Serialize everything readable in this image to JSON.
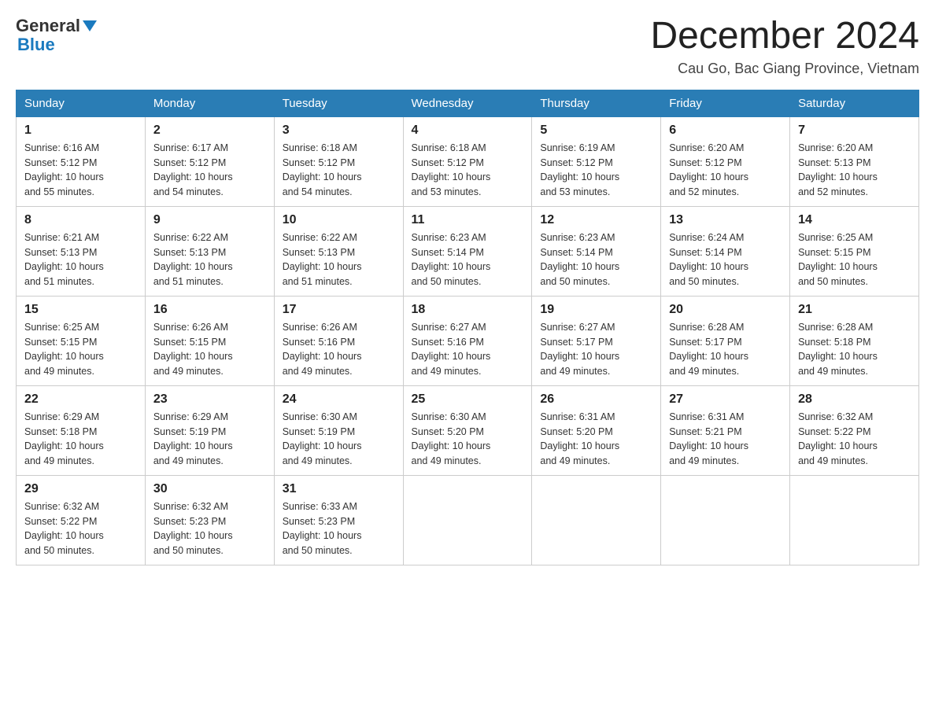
{
  "header": {
    "logo_general": "General",
    "logo_blue": "Blue",
    "month_title": "December 2024",
    "location": "Cau Go, Bac Giang Province, Vietnam"
  },
  "days_of_week": [
    "Sunday",
    "Monday",
    "Tuesday",
    "Wednesday",
    "Thursday",
    "Friday",
    "Saturday"
  ],
  "weeks": [
    [
      {
        "day": "1",
        "sunrise": "6:16 AM",
        "sunset": "5:12 PM",
        "daylight": "10 hours and 55 minutes."
      },
      {
        "day": "2",
        "sunrise": "6:17 AM",
        "sunset": "5:12 PM",
        "daylight": "10 hours and 54 minutes."
      },
      {
        "day": "3",
        "sunrise": "6:18 AM",
        "sunset": "5:12 PM",
        "daylight": "10 hours and 54 minutes."
      },
      {
        "day": "4",
        "sunrise": "6:18 AM",
        "sunset": "5:12 PM",
        "daylight": "10 hours and 53 minutes."
      },
      {
        "day": "5",
        "sunrise": "6:19 AM",
        "sunset": "5:12 PM",
        "daylight": "10 hours and 53 minutes."
      },
      {
        "day": "6",
        "sunrise": "6:20 AM",
        "sunset": "5:12 PM",
        "daylight": "10 hours and 52 minutes."
      },
      {
        "day": "7",
        "sunrise": "6:20 AM",
        "sunset": "5:13 PM",
        "daylight": "10 hours and 52 minutes."
      }
    ],
    [
      {
        "day": "8",
        "sunrise": "6:21 AM",
        "sunset": "5:13 PM",
        "daylight": "10 hours and 51 minutes."
      },
      {
        "day": "9",
        "sunrise": "6:22 AM",
        "sunset": "5:13 PM",
        "daylight": "10 hours and 51 minutes."
      },
      {
        "day": "10",
        "sunrise": "6:22 AM",
        "sunset": "5:13 PM",
        "daylight": "10 hours and 51 minutes."
      },
      {
        "day": "11",
        "sunrise": "6:23 AM",
        "sunset": "5:14 PM",
        "daylight": "10 hours and 50 minutes."
      },
      {
        "day": "12",
        "sunrise": "6:23 AM",
        "sunset": "5:14 PM",
        "daylight": "10 hours and 50 minutes."
      },
      {
        "day": "13",
        "sunrise": "6:24 AM",
        "sunset": "5:14 PM",
        "daylight": "10 hours and 50 minutes."
      },
      {
        "day": "14",
        "sunrise": "6:25 AM",
        "sunset": "5:15 PM",
        "daylight": "10 hours and 50 minutes."
      }
    ],
    [
      {
        "day": "15",
        "sunrise": "6:25 AM",
        "sunset": "5:15 PM",
        "daylight": "10 hours and 49 minutes."
      },
      {
        "day": "16",
        "sunrise": "6:26 AM",
        "sunset": "5:15 PM",
        "daylight": "10 hours and 49 minutes."
      },
      {
        "day": "17",
        "sunrise": "6:26 AM",
        "sunset": "5:16 PM",
        "daylight": "10 hours and 49 minutes."
      },
      {
        "day": "18",
        "sunrise": "6:27 AM",
        "sunset": "5:16 PM",
        "daylight": "10 hours and 49 minutes."
      },
      {
        "day": "19",
        "sunrise": "6:27 AM",
        "sunset": "5:17 PM",
        "daylight": "10 hours and 49 minutes."
      },
      {
        "day": "20",
        "sunrise": "6:28 AM",
        "sunset": "5:17 PM",
        "daylight": "10 hours and 49 minutes."
      },
      {
        "day": "21",
        "sunrise": "6:28 AM",
        "sunset": "5:18 PM",
        "daylight": "10 hours and 49 minutes."
      }
    ],
    [
      {
        "day": "22",
        "sunrise": "6:29 AM",
        "sunset": "5:18 PM",
        "daylight": "10 hours and 49 minutes."
      },
      {
        "day": "23",
        "sunrise": "6:29 AM",
        "sunset": "5:19 PM",
        "daylight": "10 hours and 49 minutes."
      },
      {
        "day": "24",
        "sunrise": "6:30 AM",
        "sunset": "5:19 PM",
        "daylight": "10 hours and 49 minutes."
      },
      {
        "day": "25",
        "sunrise": "6:30 AM",
        "sunset": "5:20 PM",
        "daylight": "10 hours and 49 minutes."
      },
      {
        "day": "26",
        "sunrise": "6:31 AM",
        "sunset": "5:20 PM",
        "daylight": "10 hours and 49 minutes."
      },
      {
        "day": "27",
        "sunrise": "6:31 AM",
        "sunset": "5:21 PM",
        "daylight": "10 hours and 49 minutes."
      },
      {
        "day": "28",
        "sunrise": "6:32 AM",
        "sunset": "5:22 PM",
        "daylight": "10 hours and 49 minutes."
      }
    ],
    [
      {
        "day": "29",
        "sunrise": "6:32 AM",
        "sunset": "5:22 PM",
        "daylight": "10 hours and 50 minutes."
      },
      {
        "day": "30",
        "sunrise": "6:32 AM",
        "sunset": "5:23 PM",
        "daylight": "10 hours and 50 minutes."
      },
      {
        "day": "31",
        "sunrise": "6:33 AM",
        "sunset": "5:23 PM",
        "daylight": "10 hours and 50 minutes."
      },
      null,
      null,
      null,
      null
    ]
  ],
  "labels": {
    "sunrise": "Sunrise:",
    "sunset": "Sunset:",
    "daylight": "Daylight:"
  }
}
